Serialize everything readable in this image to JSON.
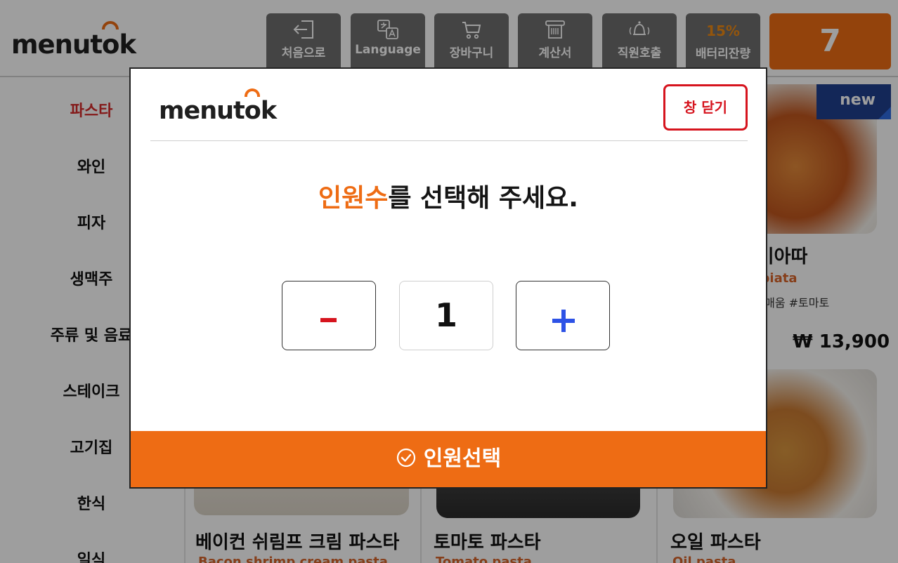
{
  "header": {
    "logo": "menutok",
    "buttons": [
      {
        "label": "처음으로",
        "icon": "home-exit-icon"
      },
      {
        "label": "Language",
        "icon": "translate-icon"
      },
      {
        "label": "장바구니",
        "icon": "cart-icon"
      },
      {
        "label": "계산서",
        "icon": "receipt-icon"
      },
      {
        "label": "직원호출",
        "icon": "bell-icon"
      },
      {
        "label": "배터리잔량",
        "value": "15%"
      }
    ],
    "table_number": "7"
  },
  "sidebar": {
    "categories": [
      "파스타",
      "와인",
      "피자",
      "생맥주",
      "주류 및 음료",
      "스테이크",
      "고기집",
      "한식",
      "일식"
    ],
    "active": "파스타"
  },
  "menu": {
    "items": [
      {
        "title": "...비아따",
        "subtitle": "...biata",
        "tags": "...#약간매움 #토마토",
        "price": "₩ 13,900",
        "badge": "new"
      },
      {
        "title": "베이컨 쉬림프 크림 파스타",
        "subtitle": "Bacon shrimp cream pasta"
      },
      {
        "title": "토마토 파스타",
        "subtitle": "Tomato pasta"
      },
      {
        "title": "오일 파스타",
        "subtitle": "Oil pasta"
      }
    ]
  },
  "modal": {
    "logo": "menutok",
    "close_label": "창 닫기",
    "prompt_highlight": "인원수",
    "prompt_rest": "를 선택해 주세요.",
    "quantity": "1",
    "confirm_label": "인원선택"
  },
  "colors": {
    "accent_orange": "#ee6c14",
    "close_red": "#d6141e",
    "plus_blue": "#2d52e6",
    "badge_navy": "#1f3f8f"
  }
}
